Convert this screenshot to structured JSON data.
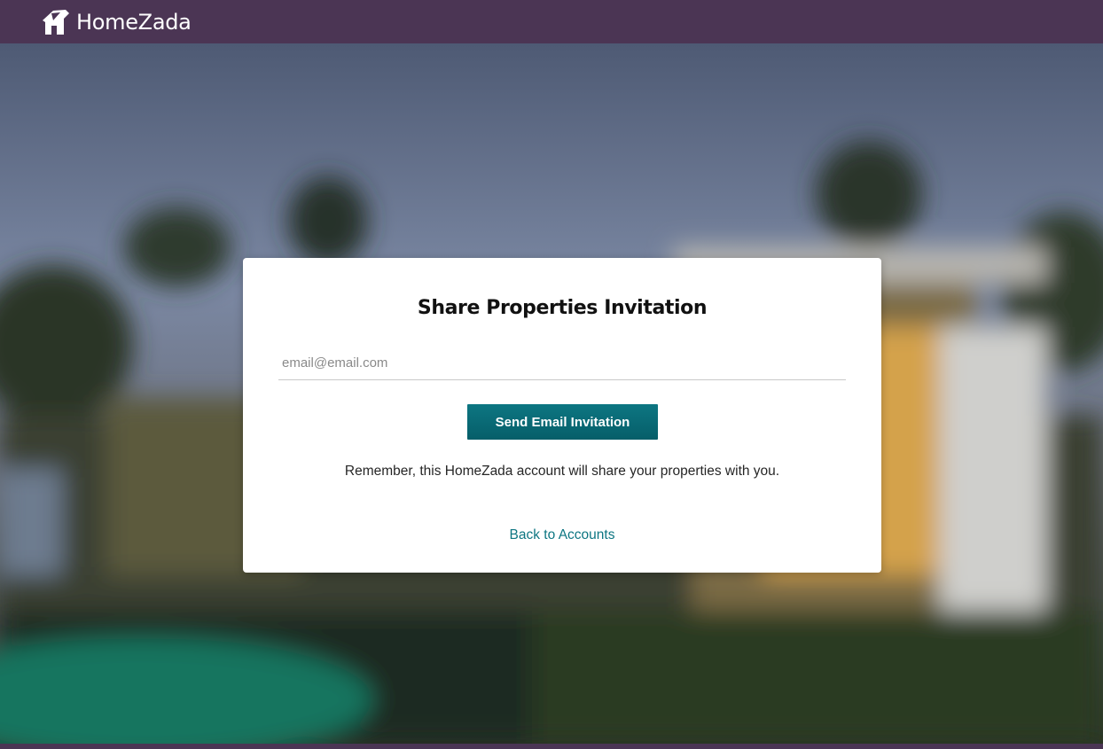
{
  "brand": {
    "name": "HomeZada",
    "color": "#4b3554",
    "icon": "house-logo-icon"
  },
  "card": {
    "title": "Share Properties Invitation",
    "email_placeholder": "email@email.com",
    "email_value": "",
    "send_button_label": "Send Email Invitation",
    "note": "Remember, this HomeZada account will share your properties with you.",
    "back_link_label": "Back to Accounts"
  },
  "colors": {
    "accent": "#0d7682",
    "header": "#4b3554"
  }
}
